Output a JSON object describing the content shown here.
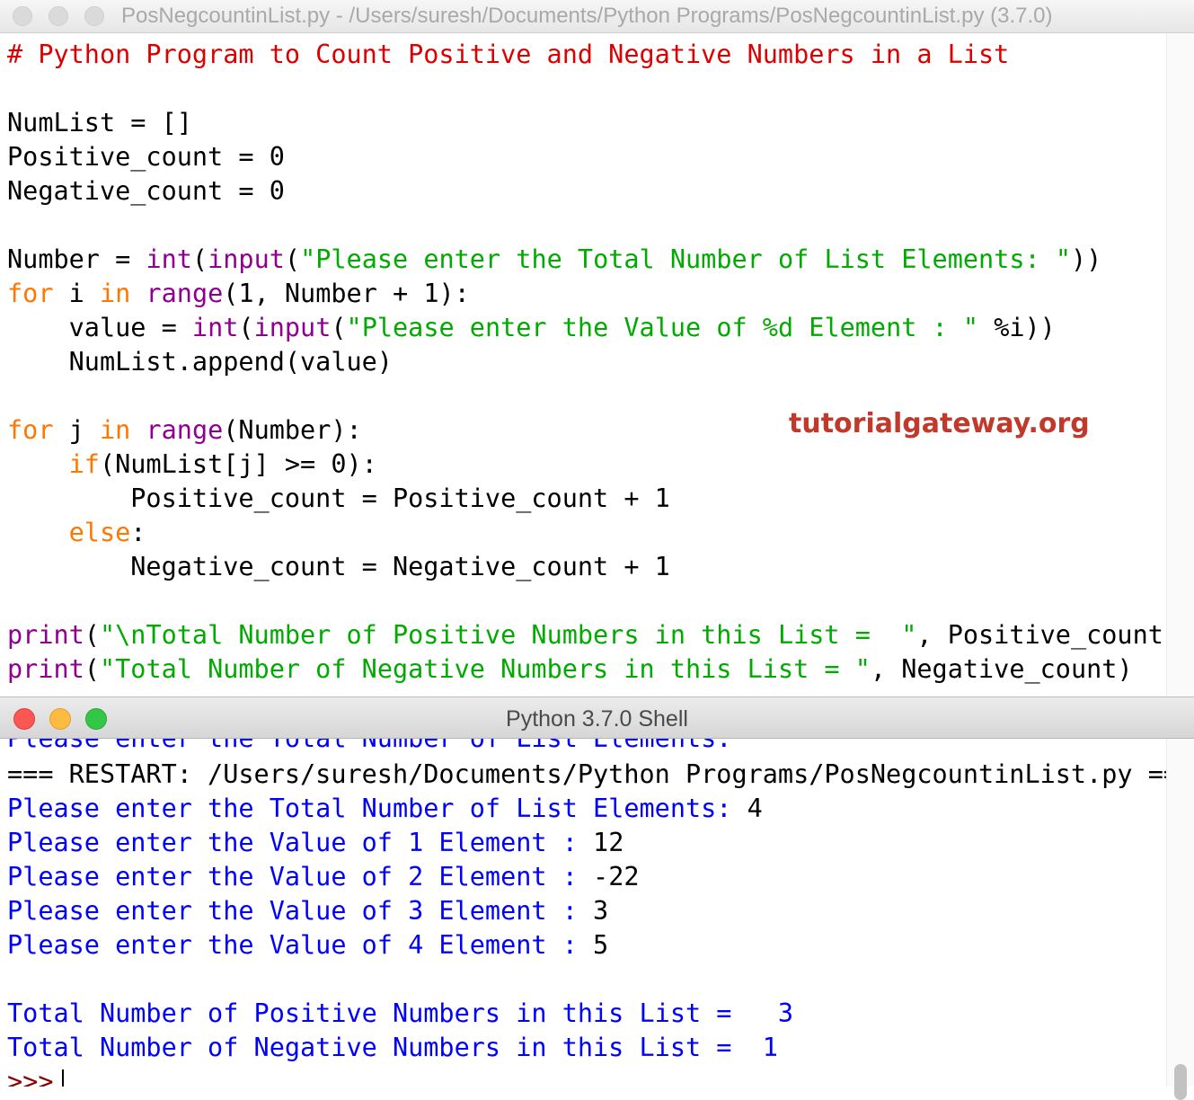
{
  "editor": {
    "title": "PosNegcountinList.py - /Users/suresh/Documents/Python Programs/PosNegcountinList.py (3.7.0)",
    "code": {
      "l01": "# Python Program to Count Positive and Negative Numbers in a List",
      "l03": "NumList = []",
      "l04": "Positive_count = 0",
      "l05": "Negative_count = 0",
      "l07a": "Number = ",
      "l07b": "int",
      "l07c": "(",
      "l07d": "input",
      "l07e": "(",
      "l07f": "\"Please enter the Total Number of List Elements: \"",
      "l07g": "))",
      "l08a": "for",
      "l08b": " i ",
      "l08c": "in",
      "l08d": " ",
      "l08e": "range",
      "l08f": "(1, Number + 1):",
      "l09a": "    value = ",
      "l09b": "int",
      "l09c": "(",
      "l09d": "input",
      "l09e": "(",
      "l09f": "\"Please enter the Value of %d Element : \"",
      "l09g": " %i))",
      "l10": "    NumList.append(value)",
      "l12a": "for",
      "l12b": " j ",
      "l12c": "in",
      "l12d": " ",
      "l12e": "range",
      "l12f": "(Number):",
      "l13a": "    ",
      "l13b": "if",
      "l13c": "(NumList[j] >= 0):",
      "l14": "        Positive_count = Positive_count + 1",
      "l15a": "    ",
      "l15b": "else",
      "l15c": ":",
      "l16": "        Negative_count = Negative_count + 1",
      "l18a": "print",
      "l18b": "(",
      "l18c": "\"\\nTotal Number of Positive Numbers in this List =  \"",
      "l18d": ", Positive_count)",
      "l19a": "print",
      "l19b": "(",
      "l19c": "\"Total Number of Negative Numbers in this List = \"",
      "l19d": ", Negative_count)"
    },
    "watermark": "tutorialgateway.org"
  },
  "shell": {
    "title": "Python 3.7.0 Shell",
    "lines": {
      "s0": "Please enter the Total Number of List Elements:",
      "s1": "=== RESTART: /Users/suresh/Documents/Python Programs/PosNegcountinList.py ===",
      "s2a": "Please enter the Total Number of List Elements: ",
      "s2b": "4",
      "s3a": "Please enter the Value of 1 Element : ",
      "s3b": "12",
      "s4a": "Please enter the Value of 2 Element : ",
      "s4b": "-22",
      "s5a": "Please enter the Value of 3 Element : ",
      "s5b": "3",
      "s6a": "Please enter the Value of 4 Element : ",
      "s6b": "5",
      "s8": "Total Number of Positive Numbers in this List =   3",
      "s9": "Total Number of Negative Numbers in this List =  1",
      "prompt": ">>>"
    }
  },
  "colors": {
    "comment": "#dd0000",
    "keyword": "#ff7700",
    "builtin": "#900090",
    "string": "#00aa00",
    "shell_output": "#0000ff",
    "watermark": "#c0392b"
  }
}
